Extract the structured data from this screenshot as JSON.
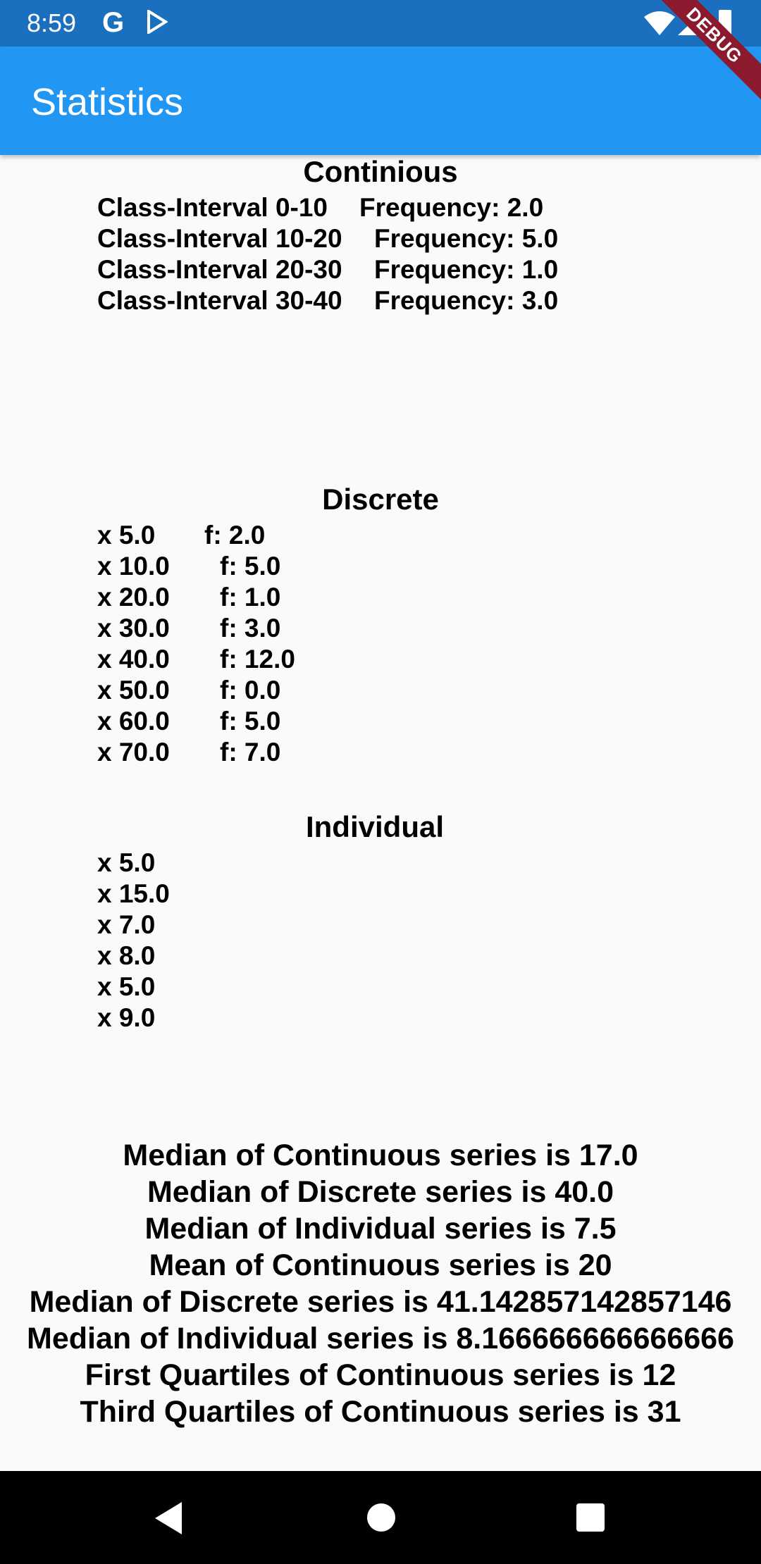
{
  "status_bar": {
    "time": "8:59",
    "icons": [
      "google-icon",
      "play-store-icon",
      "wifi-icon",
      "signal-icon",
      "battery-icon"
    ]
  },
  "app_bar": {
    "title": "Statistics"
  },
  "debug_banner": "DEBUG",
  "continuous": {
    "title": "Continious",
    "rows": [
      {
        "interval": "Class-Interval 0-10",
        "frequency": "Frequency: 2.0"
      },
      {
        "interval": "Class-Interval 10-20",
        "frequency": "Frequency: 5.0"
      },
      {
        "interval": "Class-Interval 20-30",
        "frequency": "Frequency: 1.0"
      },
      {
        "interval": "Class-Interval 30-40",
        "frequency": "Frequency: 3.0"
      }
    ]
  },
  "discrete": {
    "title": "Discrete",
    "rows": [
      {
        "x": "x 5.0",
        "f": "f: 2.0"
      },
      {
        "x": "x 10.0",
        "f": "f: 5.0"
      },
      {
        "x": "x 20.0",
        "f": "f: 1.0"
      },
      {
        "x": "x 30.0",
        "f": "f: 3.0"
      },
      {
        "x": "x 40.0",
        "f": "f: 12.0"
      },
      {
        "x": "x 50.0",
        "f": "f: 0.0"
      },
      {
        "x": "x 60.0",
        "f": "f: 5.0"
      },
      {
        "x": "x 70.0",
        "f": "f: 7.0"
      }
    ]
  },
  "individual": {
    "title": "Individual",
    "rows": [
      "x 5.0",
      "x 15.0",
      "x 7.0",
      "x 8.0",
      "x 5.0",
      "x 9.0"
    ]
  },
  "stats": [
    "Median of Continuous series is 17.0",
    "Median of Discrete series is 40.0",
    "Median of Individual series is 7.5",
    "Mean of Continuous series is 20",
    "Median of Discrete series is 41.142857142857146",
    "Median of Individual series is 8.166666666666666",
    "First Quartiles of Continuous series is 12",
    "Third Quartiles of Continuous series is 31"
  ],
  "nav_bar": {
    "icons": [
      "back-icon",
      "home-icon",
      "recents-icon"
    ]
  }
}
